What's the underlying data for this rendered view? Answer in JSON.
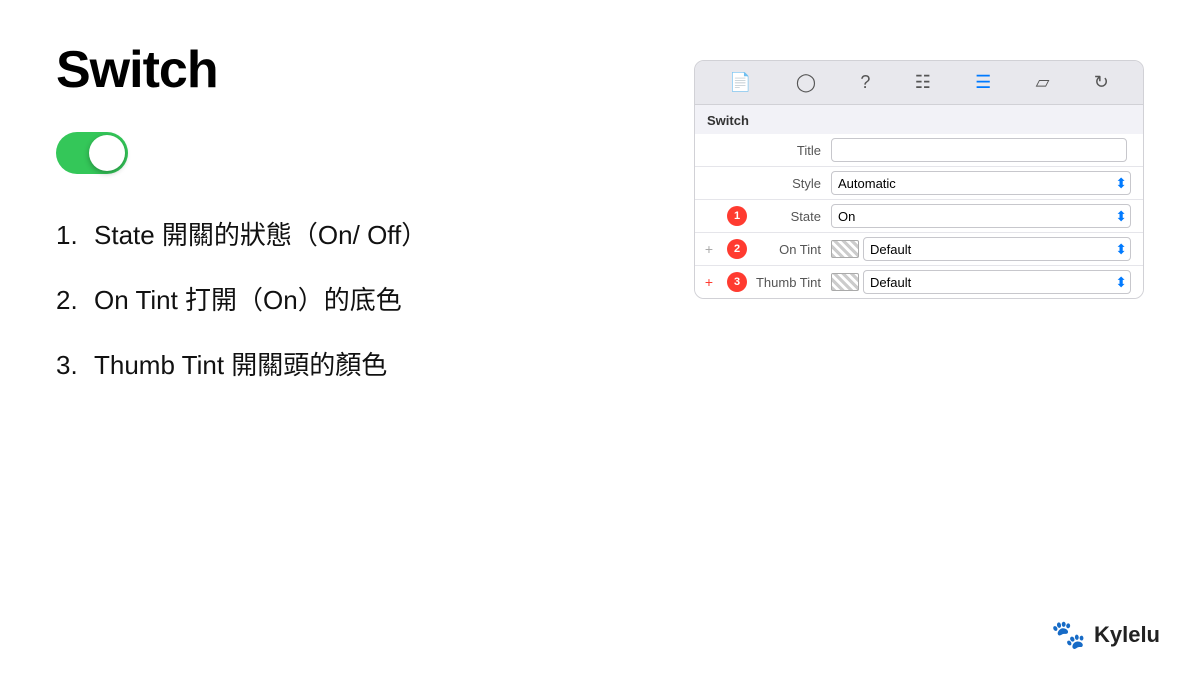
{
  "page": {
    "title": "Switch",
    "brand": {
      "name": "Kylelu",
      "icon": "🐾"
    }
  },
  "list": {
    "items": [
      {
        "num": "1.",
        "text": "State  開關的狀態（On/ Off）"
      },
      {
        "num": "2.",
        "text": "On Tint  打開（On）的底色"
      },
      {
        "num": "3.",
        "text": "Thumb Tint 開關頭的顏色"
      }
    ]
  },
  "inspector": {
    "section_title": "Switch",
    "toolbar_icons": [
      "doc",
      "clock",
      "question",
      "grid",
      "sliders",
      "ruler",
      "refresh"
    ],
    "rows": [
      {
        "id": "title-row",
        "label": "Title",
        "type": "input",
        "value": "",
        "badge": null,
        "prefix": null
      },
      {
        "id": "style-row",
        "label": "Style",
        "type": "select",
        "value": "Automatic",
        "badge": null,
        "prefix": null
      },
      {
        "id": "state-row",
        "label": "State",
        "type": "select",
        "value": "On",
        "badge": "1",
        "prefix": null
      },
      {
        "id": "ontint-row",
        "label": "On Tint",
        "type": "color-select",
        "value": "Default",
        "badge": "2",
        "prefix": "+"
      },
      {
        "id": "thumbtint-row",
        "label": "Thumb Tint",
        "type": "color-select",
        "value": "Default",
        "badge": "3",
        "prefix": "+"
      }
    ]
  }
}
